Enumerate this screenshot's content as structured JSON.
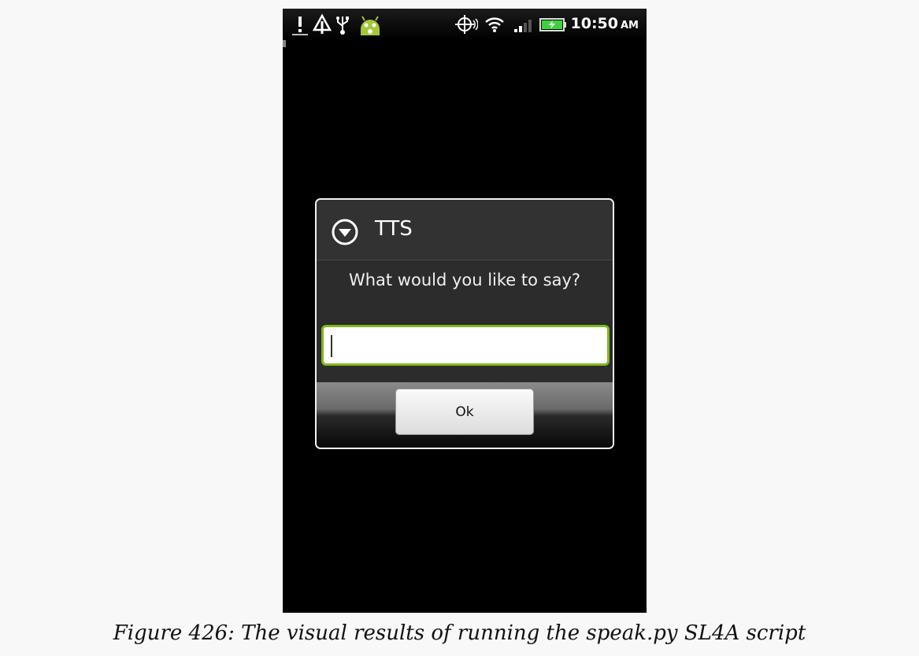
{
  "statusbar": {
    "icons": [
      "alert-icon",
      "upload-warning-icon",
      "usb-icon",
      "android-icon",
      "gps-icon",
      "wifi-icon",
      "signal-icon",
      "battery-icon"
    ],
    "time": "10:50",
    "ampm": "AM"
  },
  "dialog": {
    "title": "TTS",
    "title_icon": "dropdown-circle-icon",
    "message": "What would you like to say?",
    "input_value": "",
    "ok_label": "Ok"
  },
  "caption": "Figure 426: The visual results of running the speak.py SL4A script",
  "colors": {
    "input_focus": "#7fb81f",
    "battery_green": "#3fd23f"
  }
}
